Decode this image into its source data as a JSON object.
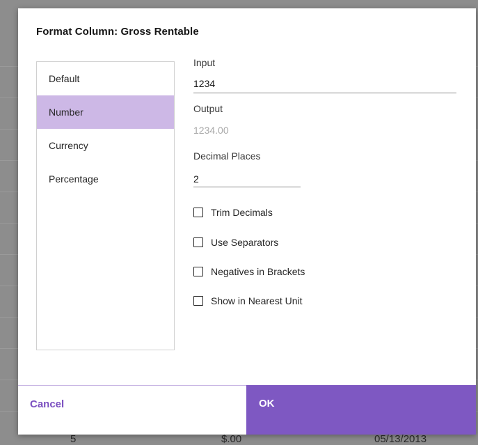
{
  "dialog": {
    "title": "Format Column: Gross Rentable"
  },
  "format_types": [
    {
      "label": "Default",
      "selected": false
    },
    {
      "label": "Number",
      "selected": true
    },
    {
      "label": "Currency",
      "selected": false
    },
    {
      "label": "Percentage",
      "selected": false
    }
  ],
  "fields": {
    "input_label": "Input",
    "input_value": "1234",
    "output_label": "Output",
    "output_value": "1234.00",
    "decimal_label": "Decimal Places",
    "decimal_value": "2"
  },
  "options": [
    {
      "label": "Trim Decimals",
      "checked": false
    },
    {
      "label": "Use Separators",
      "checked": false
    },
    {
      "label": "Negatives in Brackets",
      "checked": false
    },
    {
      "label": "Show in Nearest Unit",
      "checked": false
    }
  ],
  "footer": {
    "cancel_label": "Cancel",
    "ok_label": "OK"
  },
  "background_row": {
    "cells": [
      "5",
      "$.00",
      "05/13/2013"
    ]
  },
  "colors": {
    "accent": "#7e58c2",
    "selected_item": "#cdb8e6",
    "cancel_text": "#7b4fc0"
  }
}
